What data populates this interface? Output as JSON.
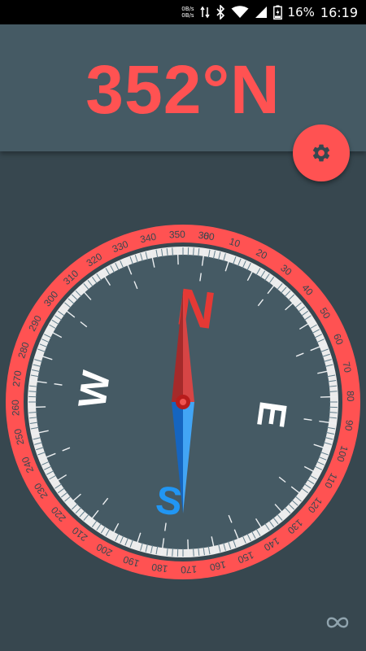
{
  "status_bar": {
    "net_speed_up": "0B/s",
    "net_speed_down": "0B/s",
    "battery_percent": "16%",
    "time": "16:19",
    "icons": [
      "data-transfer-icon",
      "bluetooth-icon",
      "wifi-icon",
      "signal-icon",
      "battery-icon"
    ]
  },
  "heading": {
    "value": "352°N"
  },
  "settings": {
    "icon": "gear-icon"
  },
  "compass": {
    "heading_degrees": 352,
    "cardinals": {
      "north": "N",
      "east": "E",
      "south": "S",
      "west": "W"
    },
    "degree_labels": [
      "0",
      "10",
      "20",
      "30",
      "40",
      "50",
      "60",
      "70",
      "80",
      "90",
      "100",
      "110",
      "120",
      "130",
      "140",
      "150",
      "160",
      "170",
      "180",
      "190",
      "200",
      "210",
      "220",
      "230",
      "240",
      "250",
      "260",
      "270",
      "280",
      "290",
      "300",
      "310",
      "320",
      "330",
      "340",
      "350",
      "360"
    ],
    "colors": {
      "accent": "#ff5252",
      "north_needle": "#c62828",
      "south_needle": "#1e88e5",
      "dial": "#455a64",
      "background": "#37474f"
    }
  },
  "footer": {
    "icon": "infinity-icon"
  }
}
